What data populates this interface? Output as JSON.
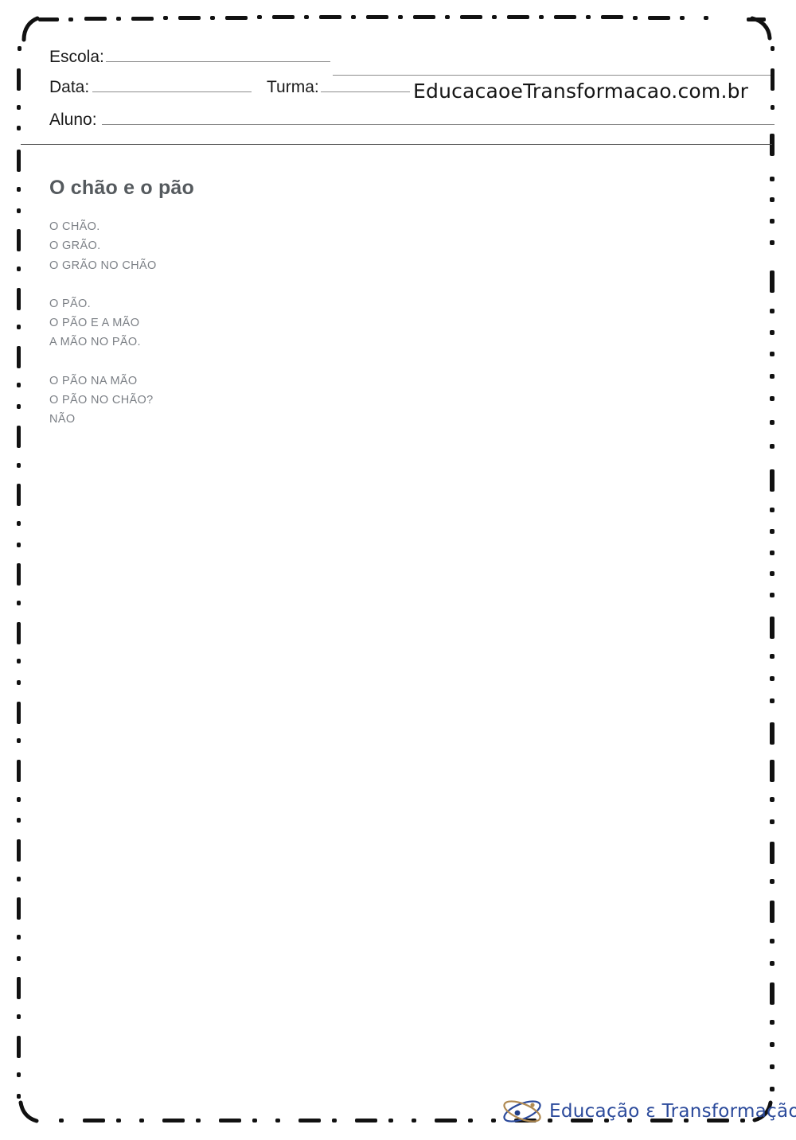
{
  "document": {
    "title": "O chão e o pão",
    "watermark": "EducacaoeTransformacao.com.br"
  },
  "header": {
    "fields": [
      {
        "label": "Escola:",
        "value": ""
      },
      {
        "label": "Data:",
        "value": ""
      },
      {
        "label": "Turma:",
        "value": ""
      },
      {
        "label": "Aluno:",
        "value": ""
      }
    ]
  },
  "poem": {
    "title": "O chão e o pão",
    "stanzas": [
      [
        "O CHÃO.",
        "O GRÃO.",
        "O GRÃO NO CHÃO"
      ],
      [
        "O PÃO.",
        "O PÃO E A MÃO",
        "A MÃO NO PÃO."
      ],
      [
        "O PÃO NA MÃO",
        "O PÃO NO CHÃO?",
        "NÃO"
      ]
    ]
  },
  "footer": {
    "brand": "Educação ɛ Transformação",
    "logo_icon": "orbit-atom-icon"
  },
  "colors": {
    "title": "#555a5e",
    "body_text": "#7c8086",
    "label_text": "#1a1a1a",
    "rule": "#4d4d4d",
    "field_line": "#8c8c8c",
    "brand_blue": "#2b4a9b",
    "brand_gold": "#b08a52",
    "frame": "#111111",
    "page_background": "#ffffff"
  }
}
